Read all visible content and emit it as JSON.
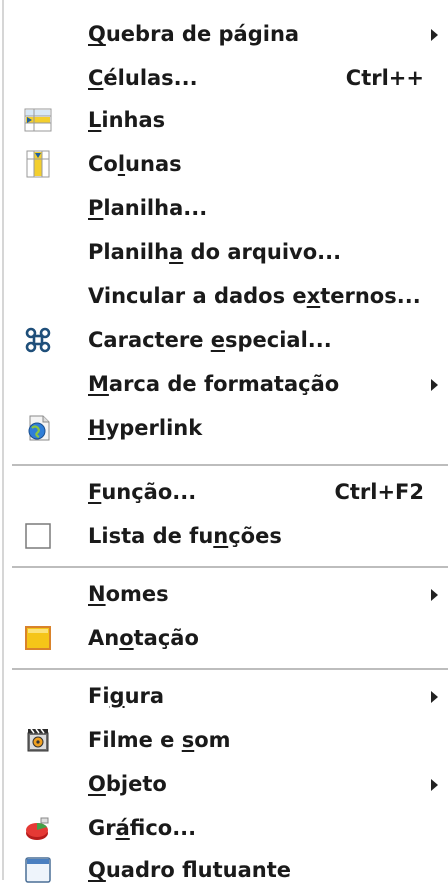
{
  "menu": {
    "items": [
      {
        "id": "quebra",
        "before": "",
        "mn": "Q",
        "after": "uebra de página",
        "submenu": true
      },
      {
        "id": "celulas",
        "before": "",
        "mn": "C",
        "after": "élulas...",
        "shortcut": "Ctrl++"
      },
      {
        "id": "linhas",
        "before": "",
        "mn": "L",
        "after": "inhas",
        "icon": "insert-rows-icon"
      },
      {
        "id": "colunas",
        "before": "Co",
        "mn": "l",
        "after": "unas",
        "icon": "insert-columns-icon"
      },
      {
        "id": "planilha",
        "before": "",
        "mn": "P",
        "after": "lanilha..."
      },
      {
        "id": "planilha-arquivo",
        "before": "Planilh",
        "mn": "a",
        "after": " do arquivo..."
      },
      {
        "id": "vincular",
        "before": "Vincular a dados e",
        "mn": "x",
        "after": "ternos..."
      },
      {
        "id": "caractere",
        "before": "Caractere ",
        "mn": "e",
        "after": "special...",
        "icon": "command-key-icon"
      },
      {
        "id": "marca",
        "before": "",
        "mn": "M",
        "after": "arca de formatação",
        "submenu": true
      },
      {
        "id": "hyperlink",
        "before": "",
        "mn": "H",
        "after": "yperlink",
        "icon": "hyperlink-icon"
      },
      {
        "id": "funcao",
        "before": "",
        "mn": "F",
        "after": "unção...",
        "shortcut": "Ctrl+F2"
      },
      {
        "id": "lista-funcoes",
        "before": "Lista de fu",
        "mn": "n",
        "after": "ções",
        "icon": "checkbox-icon"
      },
      {
        "id": "nomes",
        "before": "",
        "mn": "N",
        "after": "omes",
        "submenu": true
      },
      {
        "id": "anotacao",
        "before": "An",
        "mn": "o",
        "after": "tação",
        "icon": "comment-note-icon"
      },
      {
        "id": "figura",
        "before": "Fi",
        "mn": "g",
        "after": "ura",
        "submenu": true
      },
      {
        "id": "filme",
        "before": "Filme e ",
        "mn": "s",
        "after": "om",
        "icon": "movie-sound-icon"
      },
      {
        "id": "objeto",
        "before": "",
        "mn": "O",
        "after": "bjeto",
        "submenu": true
      },
      {
        "id": "grafico",
        "before": "Gr",
        "mn": "á",
        "after": "fico...",
        "icon": "pie-chart-icon"
      },
      {
        "id": "quadro",
        "before": "",
        "mn": "Q",
        "after": "uadro flutuante",
        "icon": "floating-frame-icon"
      }
    ]
  }
}
